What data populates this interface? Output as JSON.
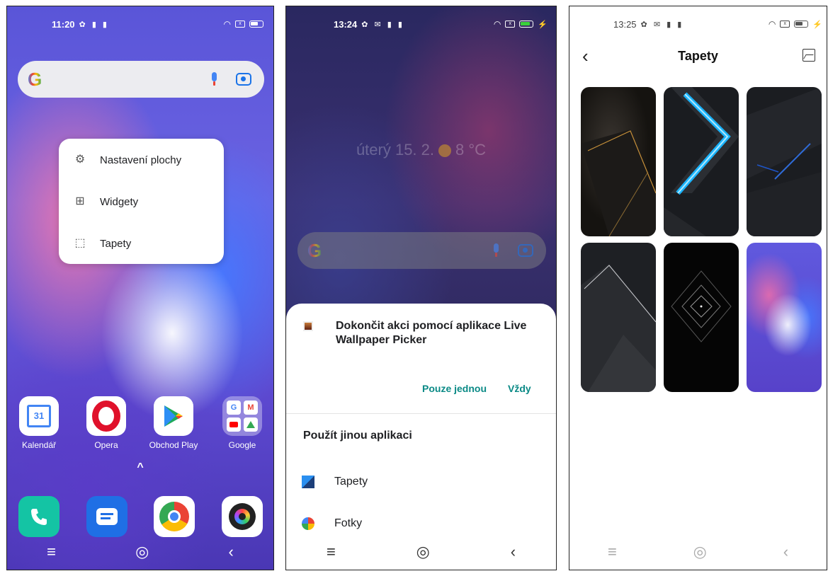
{
  "screen1": {
    "status": {
      "time": "11:20",
      "left_icons": "✿ ▮ ▮"
    },
    "popup_menu": [
      {
        "label": "Nastavení plochy",
        "icon": "gear-icon"
      },
      {
        "label": "Widgety",
        "icon": "widgets-icon"
      },
      {
        "label": "Tapety",
        "icon": "wallpaper-icon"
      }
    ],
    "apps": [
      {
        "label": "Kalendář",
        "icon": "calendar-icon",
        "badge": "31"
      },
      {
        "label": "Opera",
        "icon": "opera-icon"
      },
      {
        "label": "Obchod Play",
        "icon": "play-store-icon"
      },
      {
        "label": "Google",
        "icon": "google-folder-icon"
      }
    ],
    "dock": [
      "phone-icon",
      "messages-icon",
      "chrome-icon",
      "camera-icon"
    ],
    "drawer_arrow": "^"
  },
  "screen2": {
    "status": {
      "time": "13:24",
      "left_icons": "✿ ✉ ▮ ▮"
    },
    "date_weather": "úterý 15. 2.",
    "temperature": "8 °C",
    "sheet": {
      "title": "Dokončit akci pomocí aplikace Live Wallpaper Picker",
      "once_label": "Pouze jednou",
      "always_label": "Vždy",
      "other_label": "Použít jinou aplikaci",
      "apps": [
        {
          "label": "Tapety",
          "icon": "wallpaper-app-icon"
        },
        {
          "label": "Fotky",
          "icon": "photos-icon"
        }
      ]
    }
  },
  "screen3": {
    "status": {
      "time": "13:25",
      "left_icons": "✿ ✉ ▮ ▮"
    },
    "title": "Tapety",
    "thumbnails": [
      "dark-gold-wallpaper",
      "blue-chevron-wallpaper",
      "dark-blue-lines-wallpaper",
      "dark-peaks-wallpaper",
      "black-diamond-wallpaper",
      "purple-gradient-wallpaper"
    ]
  },
  "nav": {
    "menu": "≡",
    "home": "◎",
    "back": "‹"
  },
  "colors": {
    "accent_teal": "#0b8a86",
    "google_blue": "#4285F4"
  }
}
